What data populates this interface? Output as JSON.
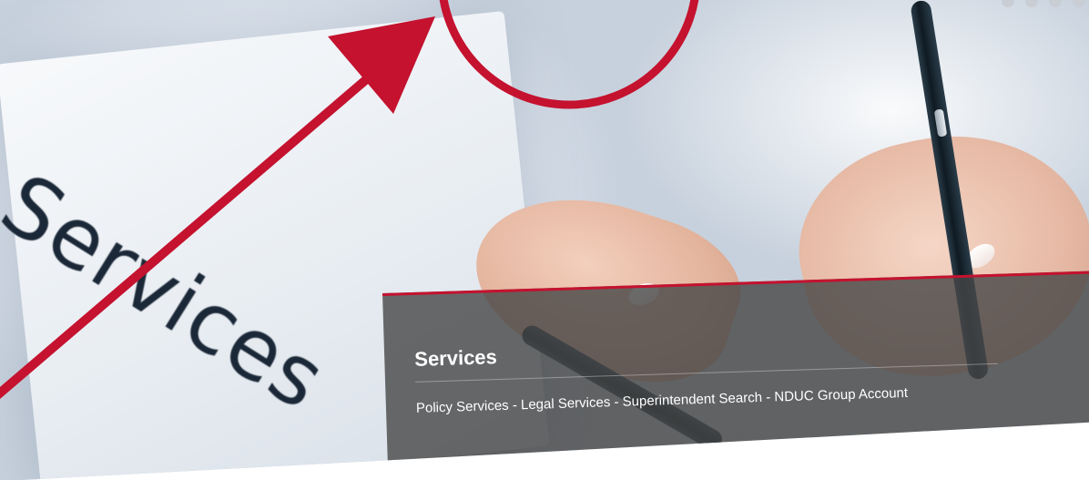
{
  "slide": {
    "image_text": "Services"
  },
  "caption": {
    "title": "Services",
    "links": [
      {
        "label": "Policy Services"
      },
      {
        "label": "Legal Services"
      },
      {
        "label": "Superintendent Search"
      },
      {
        "label": "NDUC Group Account"
      }
    ],
    "separator": " - "
  },
  "colors": {
    "accent_red": "#c4122f",
    "caption_bg": "#464646",
    "text_white": "#ffffff"
  },
  "slider": {
    "dot_count": 4
  }
}
